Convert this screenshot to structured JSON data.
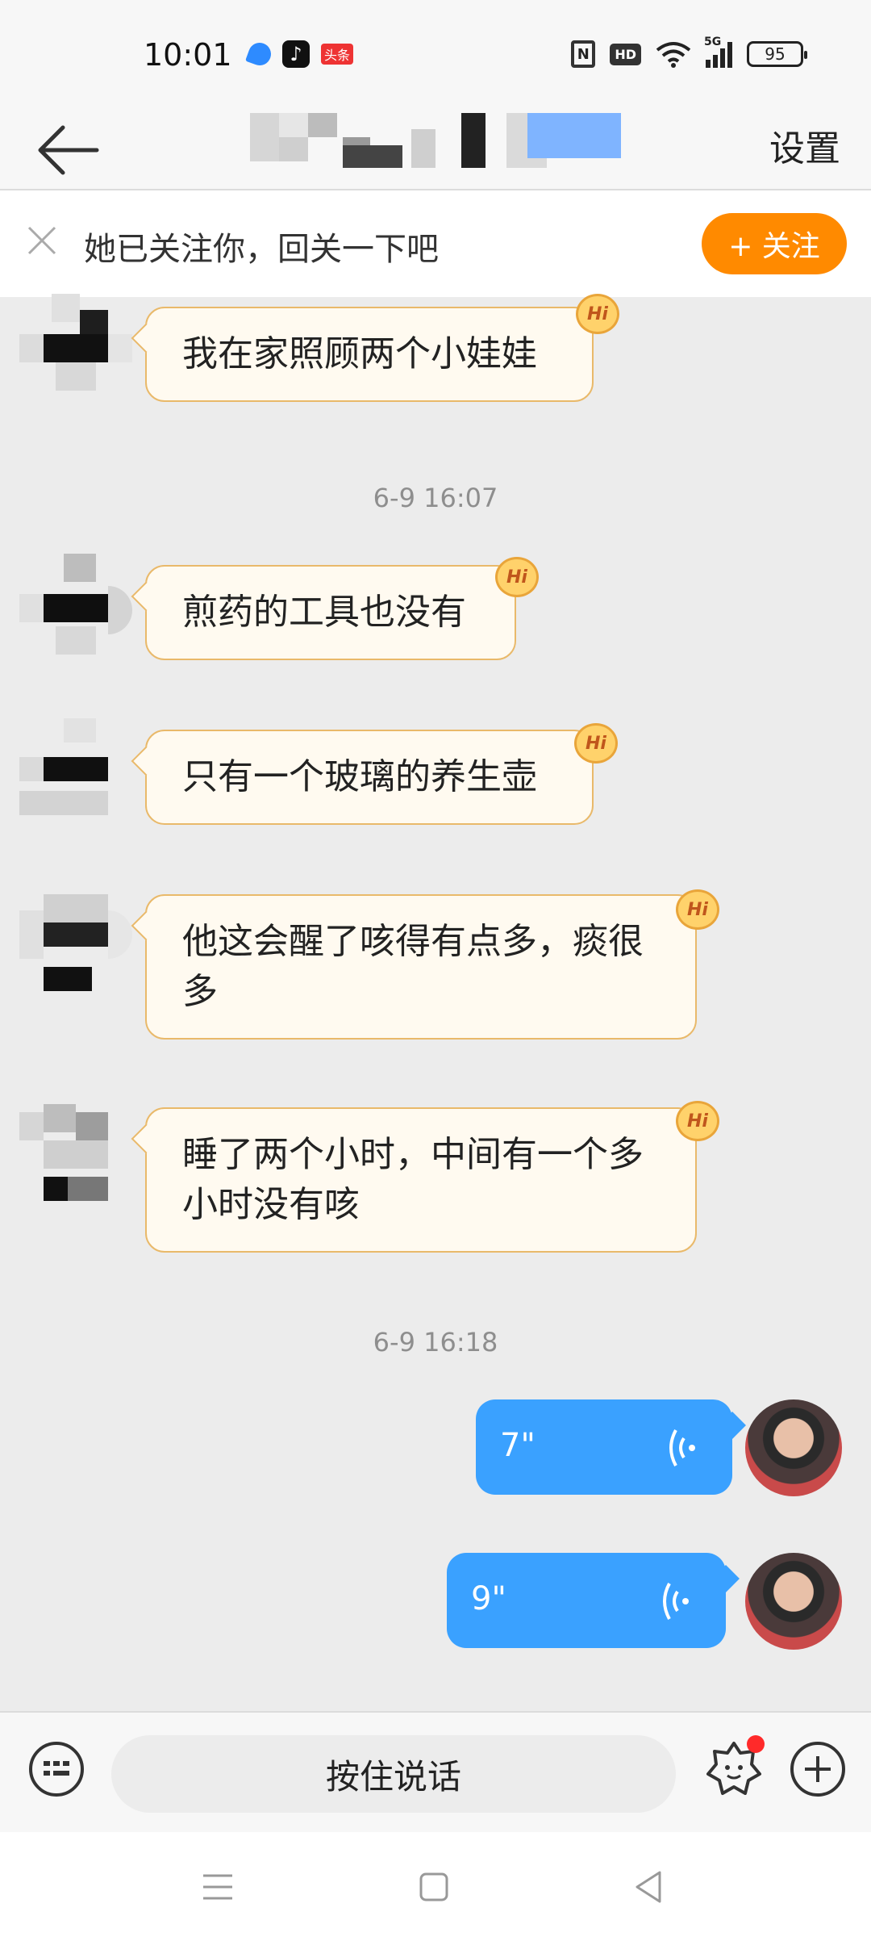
{
  "status_bar": {
    "time": "10:01",
    "battery": "95",
    "network": "5G",
    "hd_label": "HD",
    "nfc_label": "N",
    "app_icons": [
      "feather-icon",
      "tiktok-icon",
      "toutiao-icon"
    ],
    "toutiao_label": "头条"
  },
  "header": {
    "back_icon": "arrow-left-icon",
    "settings_label": "设置"
  },
  "follow_banner": {
    "text": "她已关注你，回关一下吧",
    "button_label": "+ 关注",
    "button_color": "#ff8a00"
  },
  "messages": [
    {
      "type": "received",
      "text": "我在家照顾两个小娃娃",
      "badge": "Hi"
    },
    {
      "type": "timestamp",
      "text": "6-9 16:07"
    },
    {
      "type": "received",
      "text": "煎药的工具也没有",
      "badge": "Hi"
    },
    {
      "type": "received",
      "text": "只有一个玻璃的养生壶",
      "badge": "Hi"
    },
    {
      "type": "received",
      "text": "他这会醒了咳得有点多，痰很多",
      "badge": "Hi"
    },
    {
      "type": "received",
      "text": "睡了两个小时，中间有一个多小时没有咳",
      "badge": "Hi"
    },
    {
      "type": "timestamp",
      "text": "6-9 16:18"
    },
    {
      "type": "sent_voice",
      "duration": "7\""
    },
    {
      "type": "sent_voice",
      "duration": "9\""
    }
  ],
  "input_bar": {
    "talk_label": "按住说话",
    "keyboard_icon": "keyboard-icon",
    "emoji_icon": "emoji-icon",
    "plus_icon": "plus-icon"
  },
  "nav_bar": {
    "items": [
      "menu-icon",
      "home-square-icon",
      "back-triangle-icon"
    ]
  },
  "colors": {
    "voice_bubble": "#3aa1ff",
    "received_bubble_bg": "#fffaf0",
    "received_bubble_border": "#e9b96a",
    "chat_background": "#ececec"
  }
}
